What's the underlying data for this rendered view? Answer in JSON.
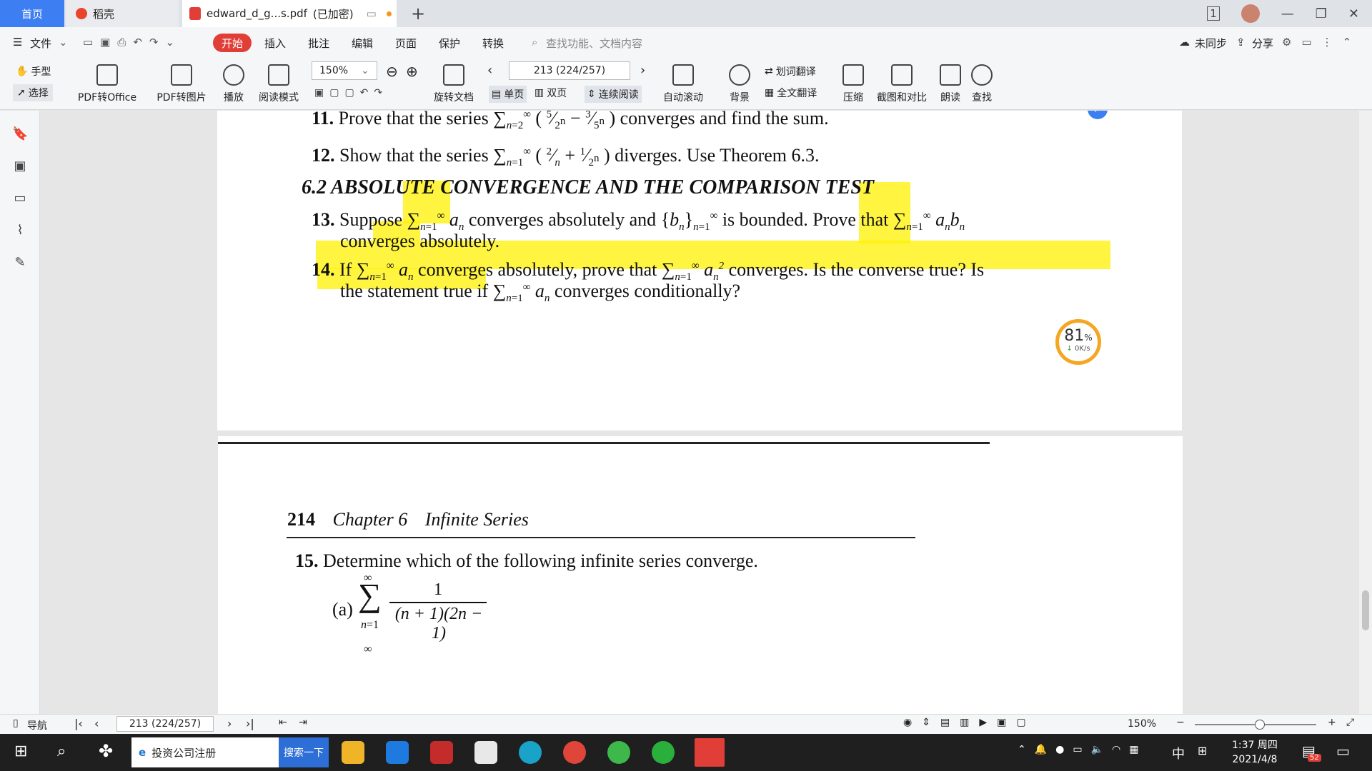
{
  "tabs": {
    "home": "首页",
    "daoke": "稻壳",
    "pdf": "edward_d_g...s.pdf",
    "encrypted": "(已加密)"
  },
  "menu": {
    "file": "文件",
    "start": "开始",
    "insert": "插入",
    "annotate": "批注",
    "edit": "编辑",
    "page": "页面",
    "protect": "保护",
    "convert": "转换",
    "search_placeholder": "查找功能、文档内容",
    "unsynced": "未同步",
    "share": "分享"
  },
  "toolbar": {
    "hand": "手型",
    "select": "选择",
    "pdf_to_office": "PDF转Office",
    "pdf_to_image": "PDF转图片",
    "play": "播放",
    "read_mode": "阅读模式",
    "zoom": "150%",
    "page_field": "213 (224/257)",
    "rotate": "旋转文档",
    "single": "单页",
    "double": "双页",
    "continuous": "连续阅读",
    "auto_scroll": "自动滚动",
    "background": "背景",
    "word_translate": "划词翻译",
    "full_translate": "全文翻译",
    "compress": "压缩",
    "screenshot_compare": "截图和对比",
    "read_aloud": "朗读",
    "find": "查找"
  },
  "document": {
    "p11": {
      "num": "11.",
      "text_a": "Prove that the series",
      "text_b": "converges and find the sum."
    },
    "p12": {
      "num": "12.",
      "text_a": "Show that the series",
      "text_b": "diverges. Use Theorem 6.3."
    },
    "section": "6.2  ABSOLUTE CONVERGENCE AND THE COMPARISON TEST",
    "p13": {
      "num": "13.",
      "text_a": "Suppose",
      "text_b": "converges absolutely and",
      "text_c": "is bounded. Prove that",
      "text_d": "converges absolutely."
    },
    "p14": {
      "num": "14.",
      "text_a": "If",
      "text_b": "converges absolutely, prove that",
      "text_c": "converges. Is the converse true? Is",
      "text_d": "the statement true if",
      "text_e": "converges conditionally?"
    },
    "header_page": "214",
    "header_chapter": "Chapter 6",
    "header_title": "Infinite Series",
    "p15": {
      "num": "15.",
      "text": "Determine which of the following infinite series converge."
    },
    "p15a": {
      "label": "(a)",
      "numerator": "1",
      "denominator": "(n + 1)(2n − 1)"
    }
  },
  "speed_widget": {
    "percent": "81",
    "unit": "%",
    "rate": "0K/s"
  },
  "statusbar": {
    "nav": "导航",
    "page_field": "213 (224/257)",
    "zoom": "150%"
  },
  "taskbar": {
    "search_text": "投资公司注册",
    "search_button": "搜索一下",
    "ime": "中",
    "time": "1:37 周四",
    "date": "2021/4/8",
    "badge": "52"
  },
  "colors": {
    "accent": "#3d7ef2",
    "start_red": "#e03e36",
    "highlight": "#fff200",
    "widget_orange": "#f5a623"
  }
}
